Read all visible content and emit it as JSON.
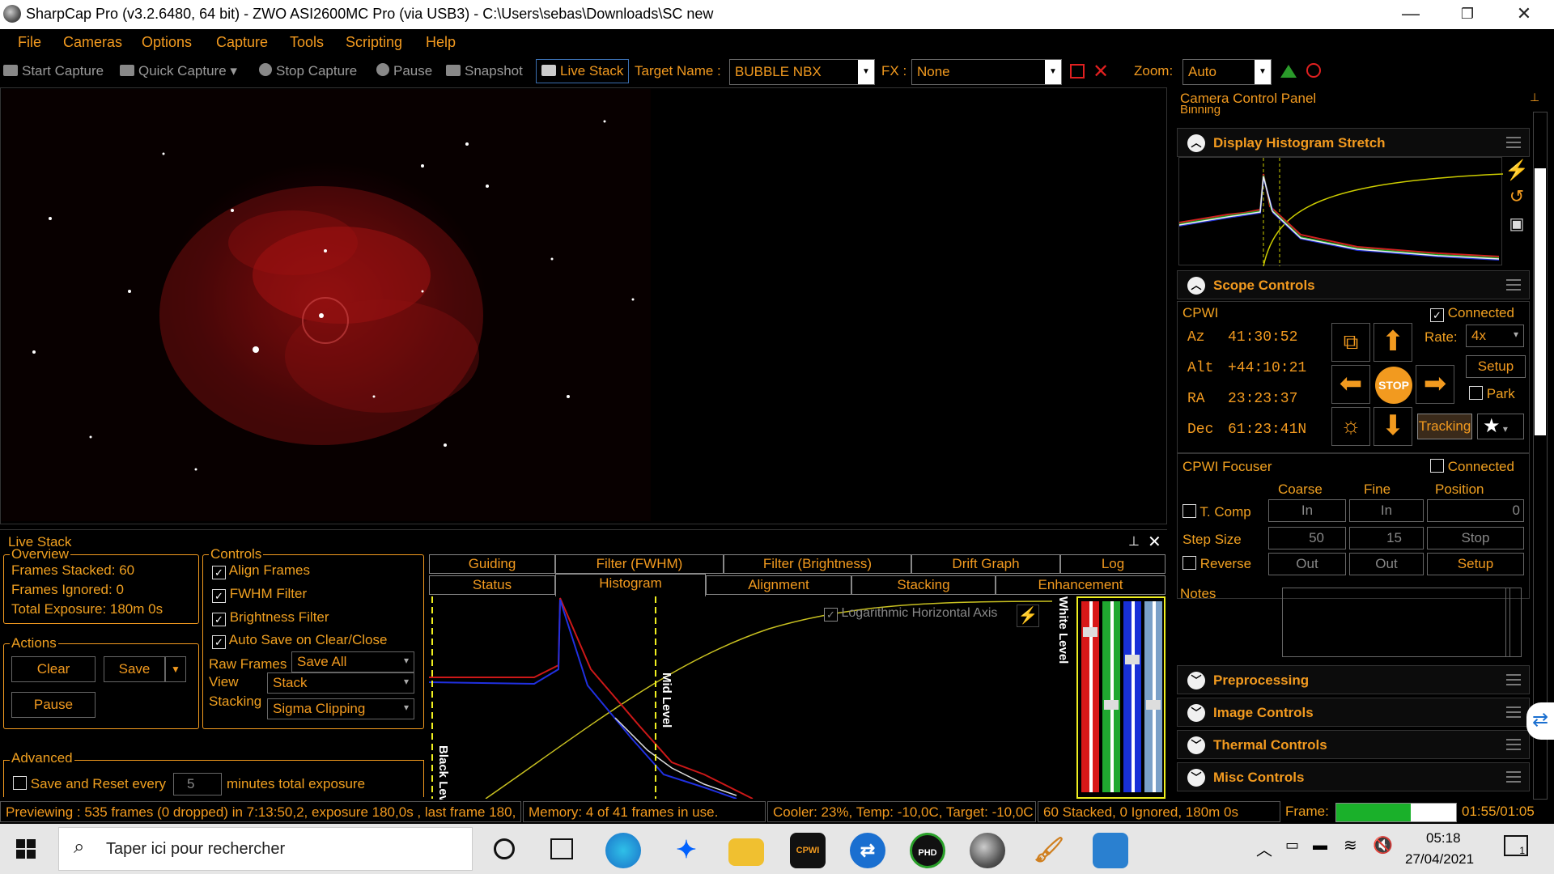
{
  "window": {
    "title": "SharpCap Pro (v3.2.6480, 64 bit) - ZWO ASI2600MC Pro (via USB3) - C:\\Users\\sebas\\Downloads\\SC new",
    "minimize": "—",
    "restore": "❐",
    "close": "✕"
  },
  "menu": [
    "File",
    "Cameras",
    "Options",
    "Capture",
    "Tools",
    "Scripting",
    "Help"
  ],
  "toolbar": {
    "start_capture": "Start Capture",
    "quick_capture": "Quick Capture",
    "stop_capture": "Stop Capture",
    "pause": "Pause",
    "snapshot": "Snapshot",
    "live_stack": "Live Stack",
    "target_label": "Target Name :",
    "target_value": "BUBBLE NBX",
    "fx_label": "FX :",
    "fx_value": "None",
    "zoom_label": "Zoom:",
    "zoom_value": "Auto"
  },
  "right_panel": {
    "title": "Camera Control Panel",
    "binning_partial": "Binning",
    "histogram_stretch": "Display Histogram Stretch",
    "scope_controls": "Scope Controls",
    "scope": {
      "name": "CPWI",
      "connected_label": "Connected",
      "connected": true,
      "az_label": "Az",
      "az": "41:30:52",
      "alt_label": "Alt",
      "alt": "+44:10:21",
      "ra_label": "RA",
      "ra": "23:23:37",
      "dec_label": "Dec",
      "dec": "61:23:41N",
      "rate_label": "Rate:",
      "rate": "4x",
      "setup": "Setup",
      "park": "Park",
      "tracking": "Tracking",
      "stop": "STOP"
    },
    "focuser": {
      "name": "CPWI Focuser",
      "connected_label": "Connected",
      "coarse": "Coarse",
      "fine": "Fine",
      "position": "Position",
      "tcomp": "T. Comp",
      "in": "In",
      "position_value": "0",
      "step_size": "Step Size",
      "coarse_step": "50",
      "fine_step": "15",
      "stop": "Stop",
      "reverse": "Reverse",
      "out": "Out",
      "setup": "Setup"
    },
    "notes": "Notes",
    "sections": [
      "Preprocessing",
      "Image Controls",
      "Thermal Controls",
      "Misc Controls"
    ]
  },
  "livestack": {
    "title": "Live Stack",
    "overview_label": "Overview",
    "frames_stacked": "Frames Stacked:  60",
    "frames_ignored": "Frames Ignored:  0",
    "total_exposure": "Total Exposure:   180m 0s",
    "actions_label": "Actions",
    "clear": "Clear",
    "save": "Save",
    "pause": "Pause",
    "controls_label": "Controls",
    "align_frames": "Align Frames",
    "fwhm_filter": "FWHM Filter",
    "brightness_filter": "Brightness Filter",
    "auto_save": "Auto Save on Clear/Close",
    "raw_frames_label": "Raw Frames",
    "raw_frames_value": "Save All",
    "view_label": "View",
    "view_value": "Stack",
    "stacking_label": "Stacking",
    "stacking_value": "Sigma Clipping",
    "advanced_label": "Advanced",
    "save_reset": "Save and Reset every",
    "minutes_value": "5",
    "minutes_label": "minutes total exposure",
    "tabs_row1": [
      "Guiding",
      "Filter (FWHM)",
      "Filter (Brightness)",
      "Drift Graph",
      "Log"
    ],
    "tabs_row2": [
      "Status",
      "Histogram",
      "Alignment",
      "Stacking",
      "Enhancement"
    ],
    "log_axis": "Logarithmic Horizontal Axis",
    "black_level": "Black Lev",
    "mid_level": "Mid Level",
    "white_level": "White Level"
  },
  "status": {
    "previewing": "Previewing : 535 frames (0 dropped) in 7:13:50,2, exposure 180,0s , last frame 180,",
    "memory": "Memory: 4 of 41 frames in use.",
    "cooler": "Cooler: 23%, Temp: -10,0C, Target: -10,0C",
    "stacked": "60 Stacked, 0 Ignored, 180m 0s",
    "frame_label": "Frame:",
    "frame_progress": 0.62,
    "frame_time": "01:55/01:05"
  },
  "taskbar": {
    "search_placeholder": "Taper ici pour rechercher",
    "time": "05:18",
    "date": "27/04/2021",
    "notif_count": "1"
  }
}
